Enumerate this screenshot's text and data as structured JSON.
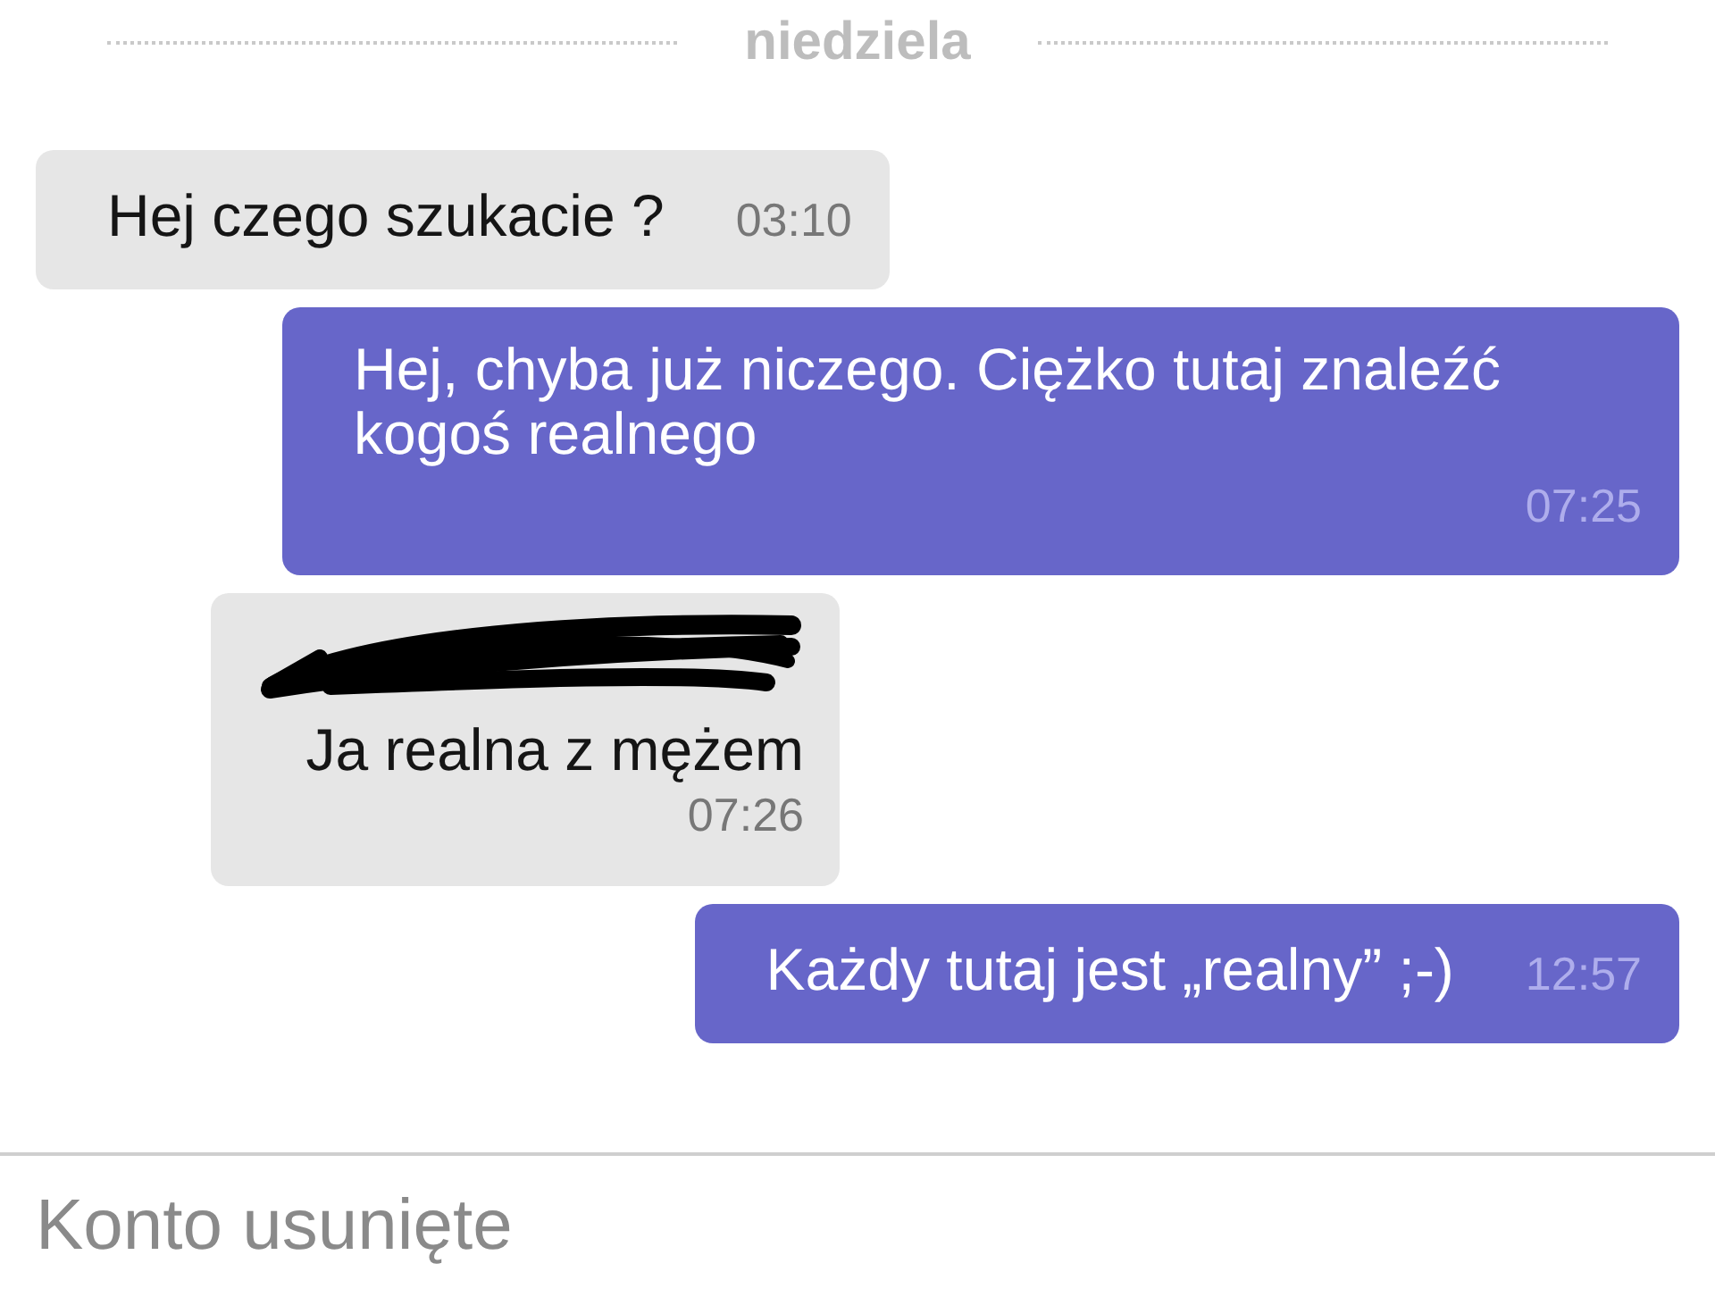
{
  "date_divider": {
    "label": "niedziela"
  },
  "messages": [
    {
      "kind": "incoming",
      "sender_redacted": false,
      "text": "Hej czego szukacie ?",
      "time": "03:10"
    },
    {
      "kind": "outgoing",
      "sender_redacted": false,
      "text": "Hej, chyba już niczego. Ciężko tutaj znaleźć kogoś realnego",
      "time": "07:25"
    },
    {
      "kind": "incoming",
      "sender_redacted": true,
      "text": "Ja realna z mężem",
      "time": "07:26"
    },
    {
      "kind": "outgoing",
      "sender_redacted": false,
      "text": "Każdy tutaj jest „realny” ;-)",
      "time": "12:57"
    }
  ],
  "footer": {
    "notice": "Konto usunięte"
  }
}
